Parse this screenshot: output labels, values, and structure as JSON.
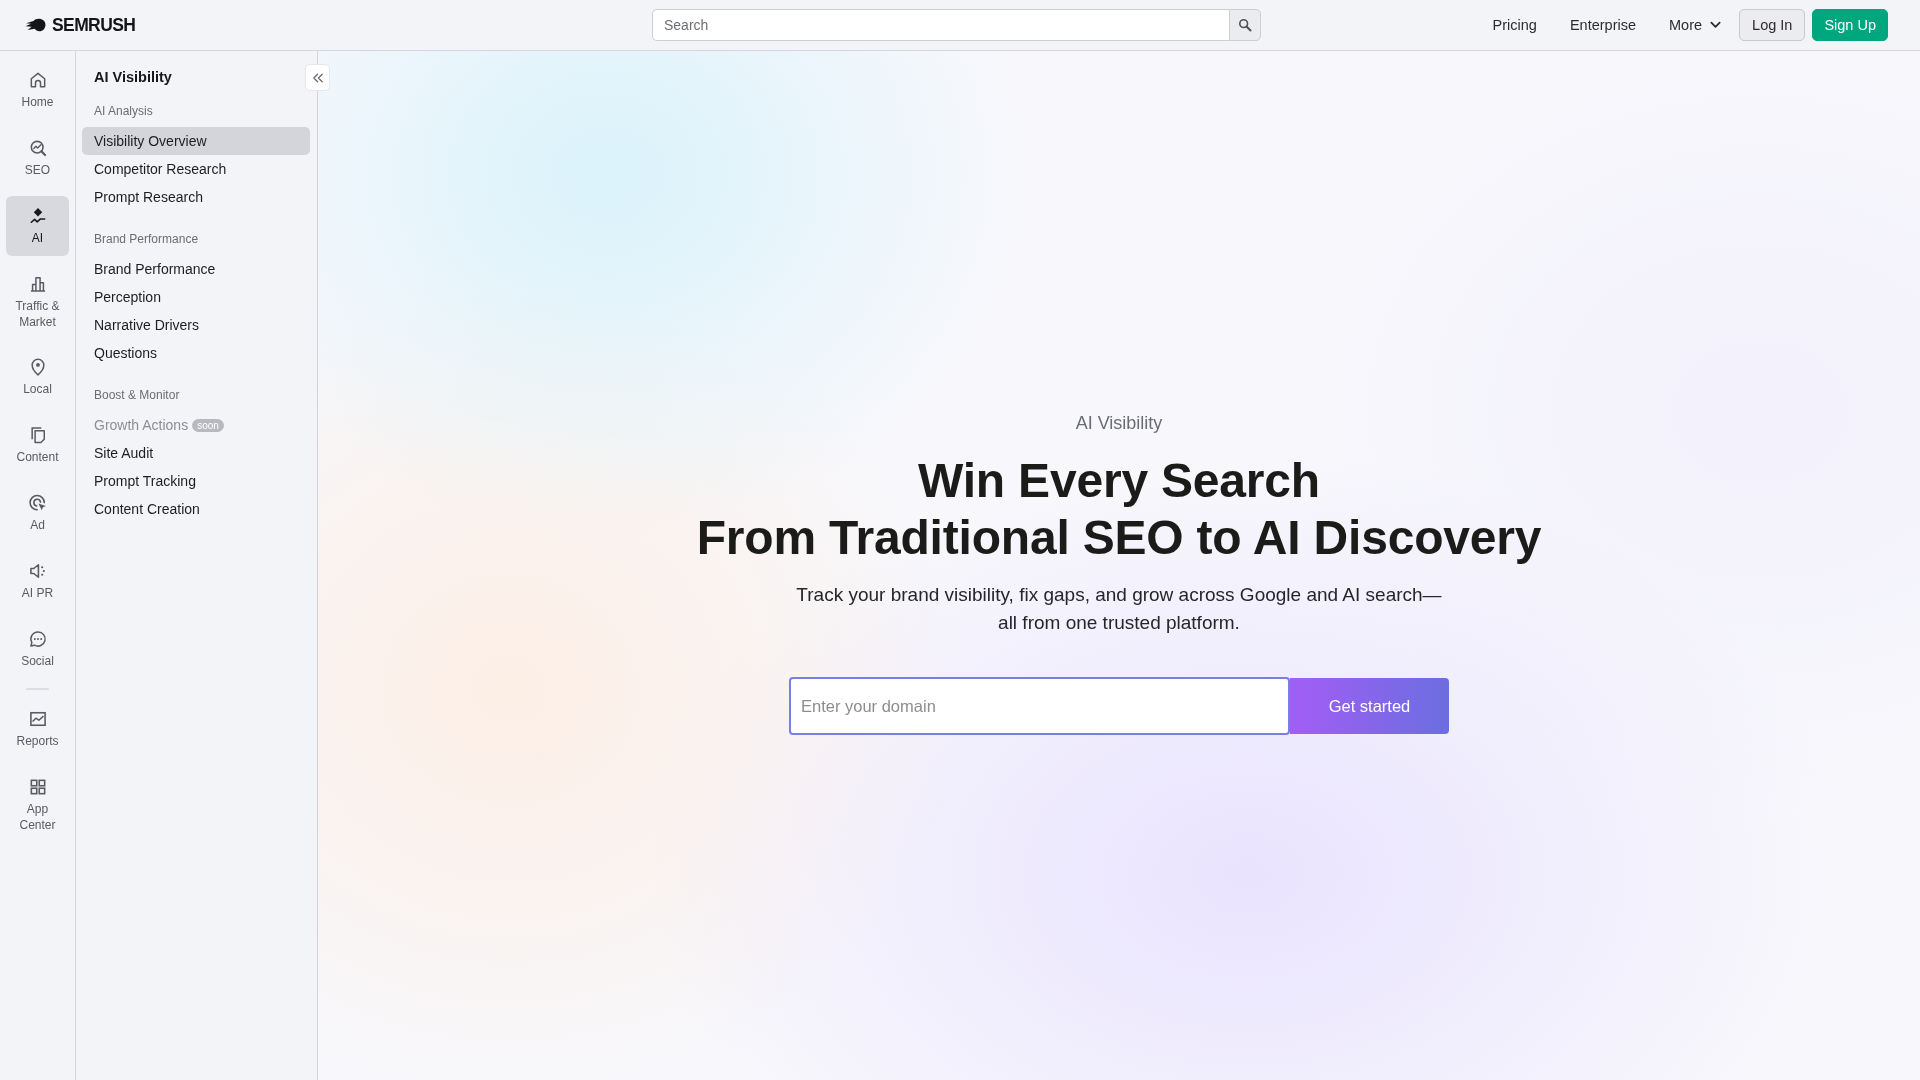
{
  "top_bar": {
    "logo": "SEMRUSH",
    "search": {
      "placeholder": "Search"
    },
    "links": [
      {
        "label": "Pricing",
        "kind": "link"
      },
      {
        "label": "Enterprise",
        "kind": "link"
      },
      {
        "label": "More",
        "kind": "dropdown"
      }
    ],
    "buttons": [
      {
        "label": "Log In",
        "kind": "secondary"
      },
      {
        "label": "Sign Up",
        "kind": "primary"
      }
    ]
  },
  "rail": {
    "groups": [
      {
        "items": [
          {
            "label": "Home",
            "selected": false
          },
          {
            "label": "SEO",
            "selected": false
          },
          {
            "label": "AI",
            "selected": true
          },
          {
            "label": "Traffic & Market",
            "selected": false
          },
          {
            "label": "Local",
            "selected": false
          },
          {
            "label": "Content",
            "selected": false
          },
          {
            "label": "Ad",
            "selected": false
          },
          {
            "label": "AI PR",
            "selected": false
          },
          {
            "label": "Social",
            "selected": false
          }
        ]
      },
      {
        "items": [
          {
            "label": "Reports",
            "selected": false
          },
          {
            "label": "App Center",
            "selected": false
          }
        ]
      }
    ]
  },
  "nav_panel": {
    "title": "AI Visibility",
    "sections": [
      {
        "heading": "AI Analysis",
        "items": [
          {
            "label": "Visibility Overview",
            "selected": true,
            "disabled": false
          },
          {
            "label": "Competitor Research",
            "selected": false,
            "disabled": false
          },
          {
            "label": "Prompt Research",
            "selected": false,
            "disabled": false
          }
        ]
      },
      {
        "heading": "Brand Performance",
        "items": [
          {
            "label": "Brand Performance",
            "selected": false,
            "disabled": false
          },
          {
            "label": "Perception",
            "selected": false,
            "disabled": false
          },
          {
            "label": "Narrative Drivers",
            "selected": false,
            "disabled": false
          },
          {
            "label": "Questions",
            "selected": false,
            "disabled": false
          }
        ]
      },
      {
        "heading": "Boost & Monitor",
        "items": [
          {
            "label": "Growth Actions",
            "selected": false,
            "disabled": true,
            "badge": "soon"
          },
          {
            "label": "Site Audit",
            "selected": false,
            "disabled": false
          },
          {
            "label": "Prompt Tracking",
            "selected": false,
            "disabled": false
          },
          {
            "label": "Content Creation",
            "selected": false,
            "disabled": false
          }
        ]
      }
    ]
  },
  "hero": {
    "eyebrow": "AI Visibility",
    "heading_lines": [
      "Win Every Search",
      "From Traditional SEO to AI Discovery"
    ],
    "subtitle": "Track your brand visibility, fix gaps, and grow across Google and AI search—all from one trusted platform.",
    "domain_field": {
      "placeholder": "Enter your domain"
    },
    "cta": "Get started"
  }
}
